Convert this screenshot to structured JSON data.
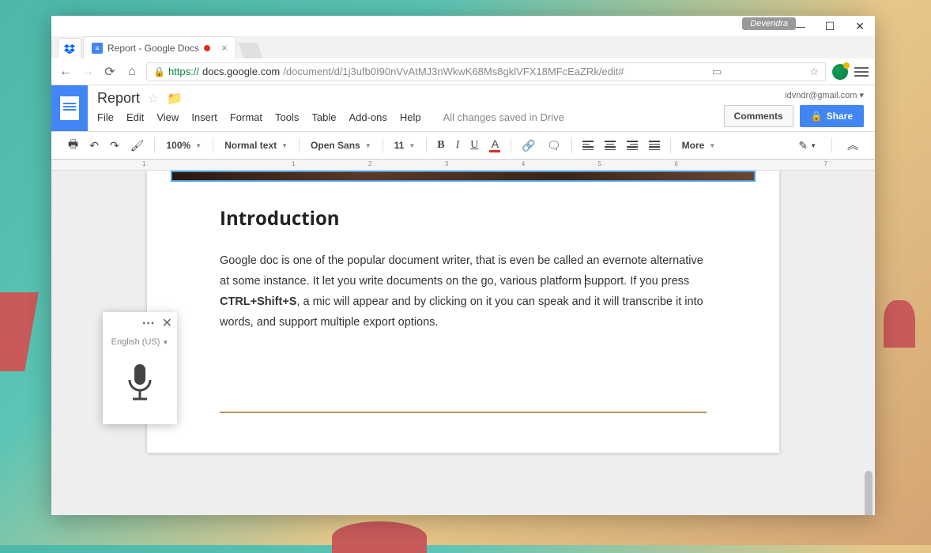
{
  "window": {
    "user_badge": "Devendra"
  },
  "browser": {
    "tab": {
      "title": "Report - Google Docs"
    },
    "url": {
      "proto": "https://",
      "domain": "docs.google.com",
      "path": "/document/d/1j3ufb0I90nVvAtMJ3nWkwK68Ms8gklVFX18MFcEaZRk/edit#"
    }
  },
  "docs": {
    "title": "Report",
    "user_email": "idvndr@gmail.com ▾",
    "menus": [
      "File",
      "Edit",
      "View",
      "Insert",
      "Format",
      "Tools",
      "Table",
      "Add-ons",
      "Help"
    ],
    "save_status": "All changes saved in Drive",
    "comments_btn": "Comments",
    "share_btn": "Share",
    "toolbar": {
      "zoom": "100%",
      "style": "Normal text",
      "font": "Open Sans",
      "size": "11",
      "more": "More"
    },
    "voice": {
      "language": "English (US)"
    },
    "content": {
      "heading": "Introduction",
      "p_before": "Google doc is one of the popular document writer, that is even be called an evernote alternative at some instance. It let you write documents on the go,  various platform ",
      "p_cursor": "s",
      "p_mid1": "upport. If you press ",
      "shortcut": "CTRL+Shift+S",
      "p_after": ", a mic will appear and by clicking on it you can speak and it will transcribe it into words, and support multiple export options."
    },
    "ruler": [
      "1",
      "",
      "1",
      "2",
      "3",
      "4",
      "5",
      "6",
      "",
      "7"
    ]
  }
}
